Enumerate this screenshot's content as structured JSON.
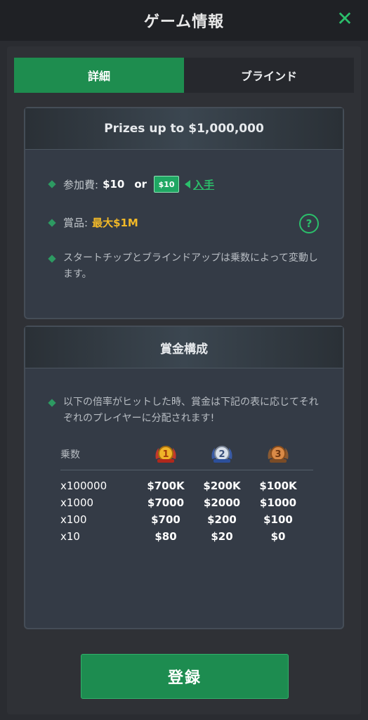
{
  "header": {
    "title": "ゲーム情報",
    "close_icon": "close-icon"
  },
  "tabs": [
    {
      "label": "詳細",
      "active": true
    },
    {
      "label": "ブラインド",
      "active": false
    }
  ],
  "panel1": {
    "title": "Prizes up to $1,000,000",
    "entry_label": "参加費:",
    "entry_value": "$10",
    "entry_or": "or",
    "ticket_text": "$10",
    "get_link": "入手",
    "prize_label": "賞品:",
    "prize_value": "最大$1M",
    "help_icon": "question-icon",
    "note": "スタートチップとブラインドアップは乗数によって変動します。"
  },
  "panel2": {
    "title": "賞金構成",
    "note": "以下の倍率がヒットした時、賞金は下記の表に応じてそれぞれのプレイヤーに分配されます!",
    "table": {
      "header_label": "乗数",
      "medals": [
        "1",
        "2",
        "3"
      ],
      "rows": [
        {
          "mult": "x100000",
          "p1": "$700K",
          "p2": "$200K",
          "p3": "$100K"
        },
        {
          "mult": "x1000",
          "p1": "$7000",
          "p2": "$2000",
          "p3": "$1000"
        },
        {
          "mult": "x100",
          "p1": "$700",
          "p2": "$200",
          "p3": "$100"
        },
        {
          "mult": "x10",
          "p1": "$80",
          "p2": "$20",
          "p3": "$0"
        }
      ]
    }
  },
  "footer": {
    "register_label": "登録"
  },
  "colors": {
    "accent": "#1e8d4f",
    "gold": "#f2b928",
    "link": "#2bbf6b"
  }
}
